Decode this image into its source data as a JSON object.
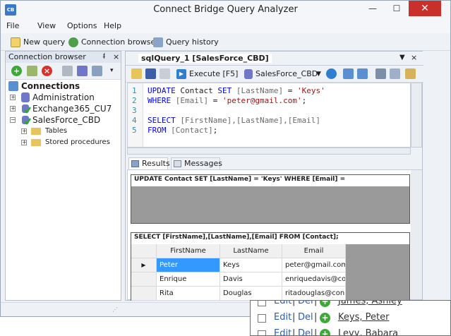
{
  "window": {
    "title": "Connect Bridge Query Analyzer",
    "icon": "app-icon",
    "minimize": "—",
    "maximize": "☐",
    "close": "✕"
  },
  "menu": {
    "items": [
      "File",
      "View",
      "Options",
      "Help"
    ]
  },
  "toolbar": {
    "new_query": "New query",
    "connection_browser": "Connection browser",
    "query_history": "Query history"
  },
  "connection_browser": {
    "title": "Connection browser",
    "pin": "ᵮ",
    "close": "×",
    "root": "Connections",
    "items": [
      {
        "label": "Administration",
        "expander": "+"
      },
      {
        "label": "Exchange365_CU7",
        "expander": "+"
      },
      {
        "label": "SalesForce_CBD",
        "expander": "−"
      },
      {
        "label": "Tables",
        "expander": "+"
      },
      {
        "label": "Stored procedures",
        "expander": "+"
      }
    ]
  },
  "query_tab": {
    "label": "sqlQuery_1 [SalesForce_CBD]",
    "arrow": "▼",
    "close": "×"
  },
  "query_toolbar": {
    "execute": "Execute [F5]",
    "database": "SalesForce_CBD",
    "db_arrow": "▼"
  },
  "editor": {
    "lines": [
      {
        "num": "1",
        "kw1": "UPDATE",
        "t1": " Contact ",
        "kw2": "SET",
        "t2": " ",
        "id1": "[LastName]",
        "t3": " = ",
        "str1": "'Keys'"
      },
      {
        "num": "2",
        "kw1": "WHERE",
        "t1": " ",
        "id1": "[Email]",
        "t2": " = ",
        "str1": "'peter@gmail.com'",
        "t3": ";"
      },
      {
        "num": "3"
      },
      {
        "num": "4",
        "kw1": "SELECT",
        "t1": " ",
        "id1": "[FirstName],[LastName],[Email]"
      },
      {
        "num": "5",
        "kw1": "FROM",
        "t1": " ",
        "id1": "[Contact]",
        "t2": ";"
      }
    ]
  },
  "results": {
    "tabs": [
      "Results",
      "Messages"
    ],
    "update_title": "UPDATE Contact SET [LastName] = 'Keys' WHERE [Email] =",
    "select_title": "SELECT [FirstName],[LastName],[Email] FROM [Contact];",
    "columns": [
      "FirstName",
      "LastName",
      "Email"
    ],
    "rows": [
      [
        "Peter",
        "Keys",
        "peter@gmail.com"
      ],
      [
        "Enrique",
        "Davis",
        "enriquedavis@co..."
      ],
      [
        "Rita",
        "Douglas",
        "ritadouglas@con..."
      ]
    ],
    "row_marker": "▶"
  },
  "overlay": {
    "edit": "Edit",
    "sep": "|",
    "del": "Del",
    "plus": "+",
    "names": [
      "James, Ashley",
      "Keys, Peter",
      "Levy, Babara"
    ]
  },
  "colors": {
    "accent": "#3399ff",
    "close": "#c9302c",
    "keyword": "#0000ff",
    "string": "#a31515"
  }
}
